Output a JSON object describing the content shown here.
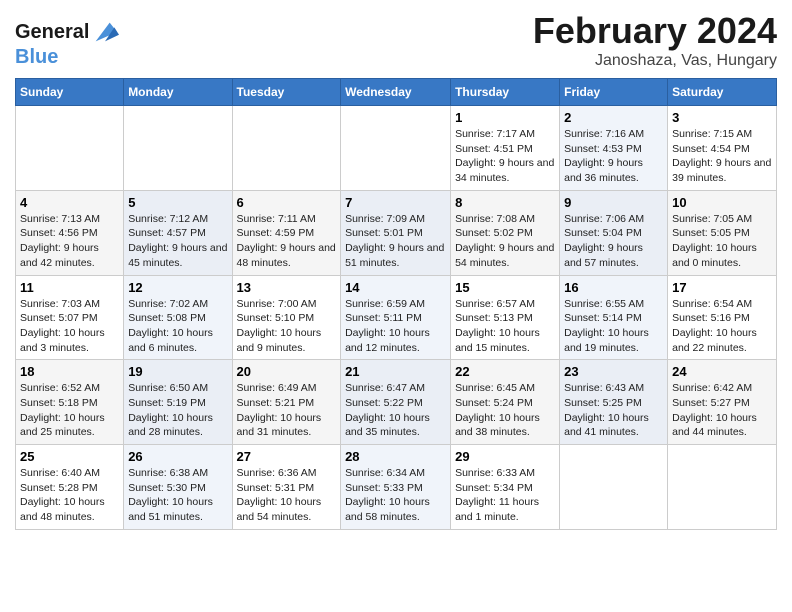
{
  "header": {
    "logo_line1": "General",
    "logo_line2": "Blue",
    "title": "February 2024",
    "subtitle": "Janoshaza, Vas, Hungary"
  },
  "days_of_week": [
    "Sunday",
    "Monday",
    "Tuesday",
    "Wednesday",
    "Thursday",
    "Friday",
    "Saturday"
  ],
  "weeks": [
    {
      "days": [
        {
          "num": "",
          "info": ""
        },
        {
          "num": "",
          "info": ""
        },
        {
          "num": "",
          "info": ""
        },
        {
          "num": "",
          "info": ""
        },
        {
          "num": "1",
          "info": "Sunrise: 7:17 AM\nSunset: 4:51 PM\nDaylight: 9 hours and 34 minutes."
        },
        {
          "num": "2",
          "info": "Sunrise: 7:16 AM\nSunset: 4:53 PM\nDaylight: 9 hours and 36 minutes."
        },
        {
          "num": "3",
          "info": "Sunrise: 7:15 AM\nSunset: 4:54 PM\nDaylight: 9 hours and 39 minutes."
        }
      ]
    },
    {
      "days": [
        {
          "num": "4",
          "info": "Sunrise: 7:13 AM\nSunset: 4:56 PM\nDaylight: 9 hours and 42 minutes."
        },
        {
          "num": "5",
          "info": "Sunrise: 7:12 AM\nSunset: 4:57 PM\nDaylight: 9 hours and 45 minutes."
        },
        {
          "num": "6",
          "info": "Sunrise: 7:11 AM\nSunset: 4:59 PM\nDaylight: 9 hours and 48 minutes."
        },
        {
          "num": "7",
          "info": "Sunrise: 7:09 AM\nSunset: 5:01 PM\nDaylight: 9 hours and 51 minutes."
        },
        {
          "num": "8",
          "info": "Sunrise: 7:08 AM\nSunset: 5:02 PM\nDaylight: 9 hours and 54 minutes."
        },
        {
          "num": "9",
          "info": "Sunrise: 7:06 AM\nSunset: 5:04 PM\nDaylight: 9 hours and 57 minutes."
        },
        {
          "num": "10",
          "info": "Sunrise: 7:05 AM\nSunset: 5:05 PM\nDaylight: 10 hours and 0 minutes."
        }
      ]
    },
    {
      "days": [
        {
          "num": "11",
          "info": "Sunrise: 7:03 AM\nSunset: 5:07 PM\nDaylight: 10 hours and 3 minutes."
        },
        {
          "num": "12",
          "info": "Sunrise: 7:02 AM\nSunset: 5:08 PM\nDaylight: 10 hours and 6 minutes."
        },
        {
          "num": "13",
          "info": "Sunrise: 7:00 AM\nSunset: 5:10 PM\nDaylight: 10 hours and 9 minutes."
        },
        {
          "num": "14",
          "info": "Sunrise: 6:59 AM\nSunset: 5:11 PM\nDaylight: 10 hours and 12 minutes."
        },
        {
          "num": "15",
          "info": "Sunrise: 6:57 AM\nSunset: 5:13 PM\nDaylight: 10 hours and 15 minutes."
        },
        {
          "num": "16",
          "info": "Sunrise: 6:55 AM\nSunset: 5:14 PM\nDaylight: 10 hours and 19 minutes."
        },
        {
          "num": "17",
          "info": "Sunrise: 6:54 AM\nSunset: 5:16 PM\nDaylight: 10 hours and 22 minutes."
        }
      ]
    },
    {
      "days": [
        {
          "num": "18",
          "info": "Sunrise: 6:52 AM\nSunset: 5:18 PM\nDaylight: 10 hours and 25 minutes."
        },
        {
          "num": "19",
          "info": "Sunrise: 6:50 AM\nSunset: 5:19 PM\nDaylight: 10 hours and 28 minutes."
        },
        {
          "num": "20",
          "info": "Sunrise: 6:49 AM\nSunset: 5:21 PM\nDaylight: 10 hours and 31 minutes."
        },
        {
          "num": "21",
          "info": "Sunrise: 6:47 AM\nSunset: 5:22 PM\nDaylight: 10 hours and 35 minutes."
        },
        {
          "num": "22",
          "info": "Sunrise: 6:45 AM\nSunset: 5:24 PM\nDaylight: 10 hours and 38 minutes."
        },
        {
          "num": "23",
          "info": "Sunrise: 6:43 AM\nSunset: 5:25 PM\nDaylight: 10 hours and 41 minutes."
        },
        {
          "num": "24",
          "info": "Sunrise: 6:42 AM\nSunset: 5:27 PM\nDaylight: 10 hours and 44 minutes."
        }
      ]
    },
    {
      "days": [
        {
          "num": "25",
          "info": "Sunrise: 6:40 AM\nSunset: 5:28 PM\nDaylight: 10 hours and 48 minutes."
        },
        {
          "num": "26",
          "info": "Sunrise: 6:38 AM\nSunset: 5:30 PM\nDaylight: 10 hours and 51 minutes."
        },
        {
          "num": "27",
          "info": "Sunrise: 6:36 AM\nSunset: 5:31 PM\nDaylight: 10 hours and 54 minutes."
        },
        {
          "num": "28",
          "info": "Sunrise: 6:34 AM\nSunset: 5:33 PM\nDaylight: 10 hours and 58 minutes."
        },
        {
          "num": "29",
          "info": "Sunrise: 6:33 AM\nSunset: 5:34 PM\nDaylight: 11 hours and 1 minute."
        },
        {
          "num": "",
          "info": ""
        },
        {
          "num": "",
          "info": ""
        }
      ]
    }
  ]
}
